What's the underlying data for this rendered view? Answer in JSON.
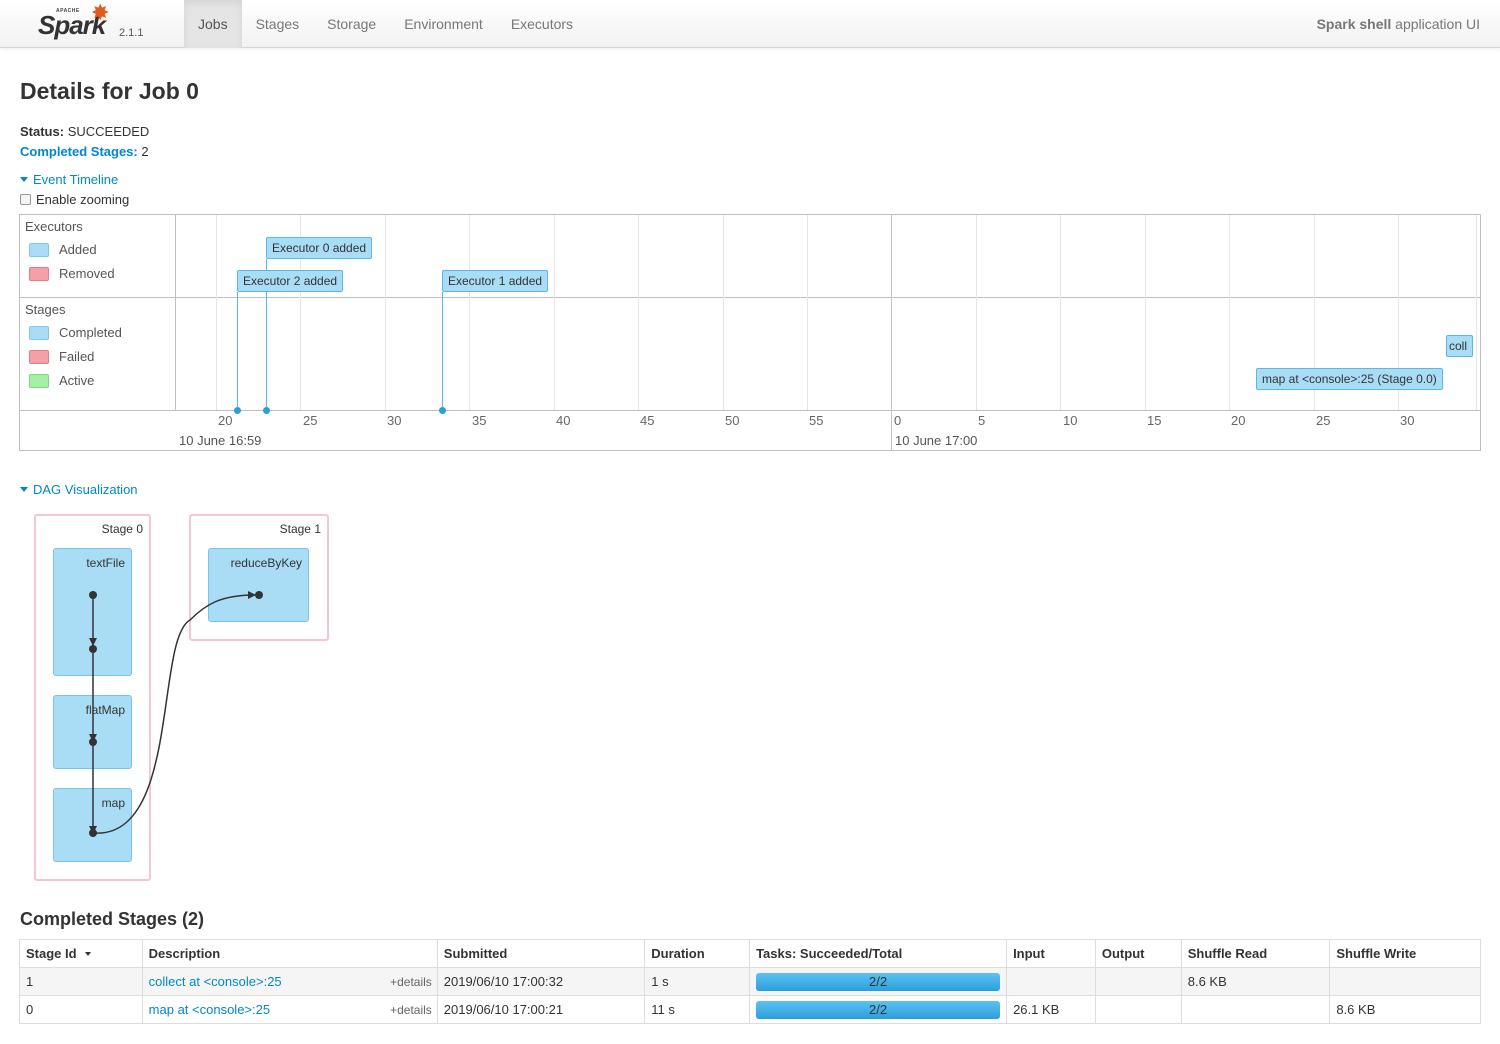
{
  "nav": {
    "brand_small": "APACHE",
    "brand_word": "Spark",
    "version": "2.1.1",
    "tabs": [
      "Jobs",
      "Stages",
      "Storage",
      "Environment",
      "Executors"
    ],
    "app_title_bold": "Spark shell",
    "app_title_rest": " application UI"
  },
  "page": {
    "title": "Details for Job 0",
    "status_label": "Status:",
    "status_value": "SUCCEEDED",
    "completed_label": "Completed Stages:",
    "completed_value": "2"
  },
  "timeline": {
    "toggle_label": "Event Timeline",
    "zoom_label": "Enable zooming",
    "executors_title": "Executors",
    "executors_legend": [
      "Added",
      "Removed"
    ],
    "stages_title": "Stages",
    "stages_legend": [
      "Completed",
      "Failed",
      "Active"
    ],
    "events": [
      "Executor 0 added",
      "Executor 2 added",
      "Executor 1 added"
    ],
    "stage_items": [
      "coll",
      "map at <console>:25 (Stage 0.0)"
    ],
    "minute_ticks": [
      "20",
      "25",
      "30",
      "35",
      "40",
      "45",
      "50",
      "55"
    ],
    "second_ticks": [
      "0",
      "5",
      "10",
      "15",
      "20",
      "25",
      "30"
    ],
    "major_labels": [
      "10 June 16:59",
      "10 June 17:00"
    ]
  },
  "dag": {
    "toggle_label": "DAG Visualization",
    "stages": [
      "Stage 0",
      "Stage 1"
    ],
    "rdds": [
      "textFile",
      "flatMap",
      "map",
      "reduceByKey"
    ]
  },
  "table": {
    "title": "Completed Stages (2)",
    "headers": [
      "Stage Id",
      "Description",
      "Submitted",
      "Duration",
      "Tasks: Succeeded/Total",
      "Input",
      "Output",
      "Shuffle Read",
      "Shuffle Write"
    ],
    "rows": [
      {
        "id": "1",
        "desc": "collect at <console>:25",
        "details": "+details",
        "submitted": "2019/06/10 17:00:32",
        "duration": "1 s",
        "tasks": "2/2",
        "input": "",
        "output": "",
        "shuffle_read": "8.6 KB",
        "shuffle_write": ""
      },
      {
        "id": "0",
        "desc": "map at <console>:25",
        "details": "+details",
        "submitted": "2019/06/10 17:00:21",
        "duration": "11 s",
        "tasks": "2/2",
        "input": "26.1 KB",
        "output": "",
        "shuffle_read": "",
        "shuffle_write": "8.6 KB"
      }
    ]
  },
  "colors": {
    "accent": "#0088cc",
    "completed": "#a8ddf5",
    "failed": "#f4a0a8",
    "active": "#a6f0a6",
    "progress": "#3eaee8"
  }
}
